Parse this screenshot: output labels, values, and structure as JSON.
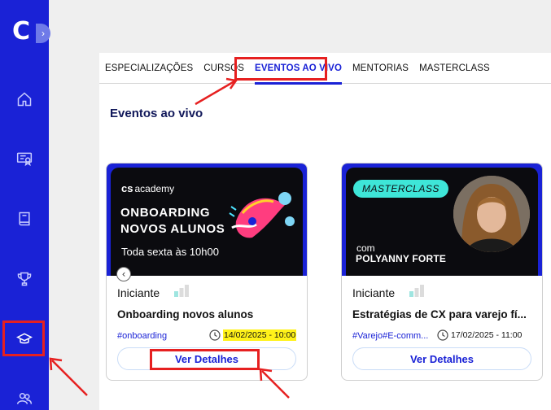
{
  "sidebar": {
    "logo": "C",
    "collapse_icon": "chevron-right-icon",
    "items": [
      {
        "name": "home",
        "icon": "home-icon"
      },
      {
        "name": "certificate",
        "icon": "certificate-icon"
      },
      {
        "name": "book",
        "icon": "book-icon"
      },
      {
        "name": "trophy",
        "icon": "trophy-icon"
      },
      {
        "name": "courses",
        "icon": "graduation-cap-icon",
        "active": true
      },
      {
        "name": "community",
        "icon": "users-icon"
      }
    ]
  },
  "tabs": [
    {
      "label": "ESPECIALIZAÇÕES"
    },
    {
      "label": "CURSOS"
    },
    {
      "label": "EVENTOS AO VIVO",
      "active": true
    },
    {
      "label": "MENTORIAS"
    },
    {
      "label": "MASTERCLASS"
    }
  ],
  "section_title": "Eventos ao vivo",
  "cards": [
    {
      "banner": {
        "brand_mark": "cs",
        "brand_text": "academy",
        "title_line1": "ONBOARDING",
        "title_line2": "NOVOS ALUNOS",
        "subtitle": "Toda sexta às 10h00"
      },
      "level": "Iniciante",
      "title": "Onboarding novos alunos",
      "tag": "#onboarding",
      "date": "14/02/2025 - 10:00",
      "button": "Ver Detalhes"
    },
    {
      "banner": {
        "badge": "MASTERCLASS",
        "com": "com",
        "speaker": "POLYANNY FORTE"
      },
      "level": "Iniciante",
      "title": "Estratégias de CX para varejo fí...",
      "tag": "#Varejo#E-comm...",
      "date": "17/02/2025 - 11:00",
      "button": "Ver Detalhes"
    }
  ],
  "colors": {
    "brand_blue": "#1a22d6",
    "highlight_red": "#e62020",
    "date_highlight": "#fff21a",
    "badge_cyan": "#3ee6d8"
  }
}
